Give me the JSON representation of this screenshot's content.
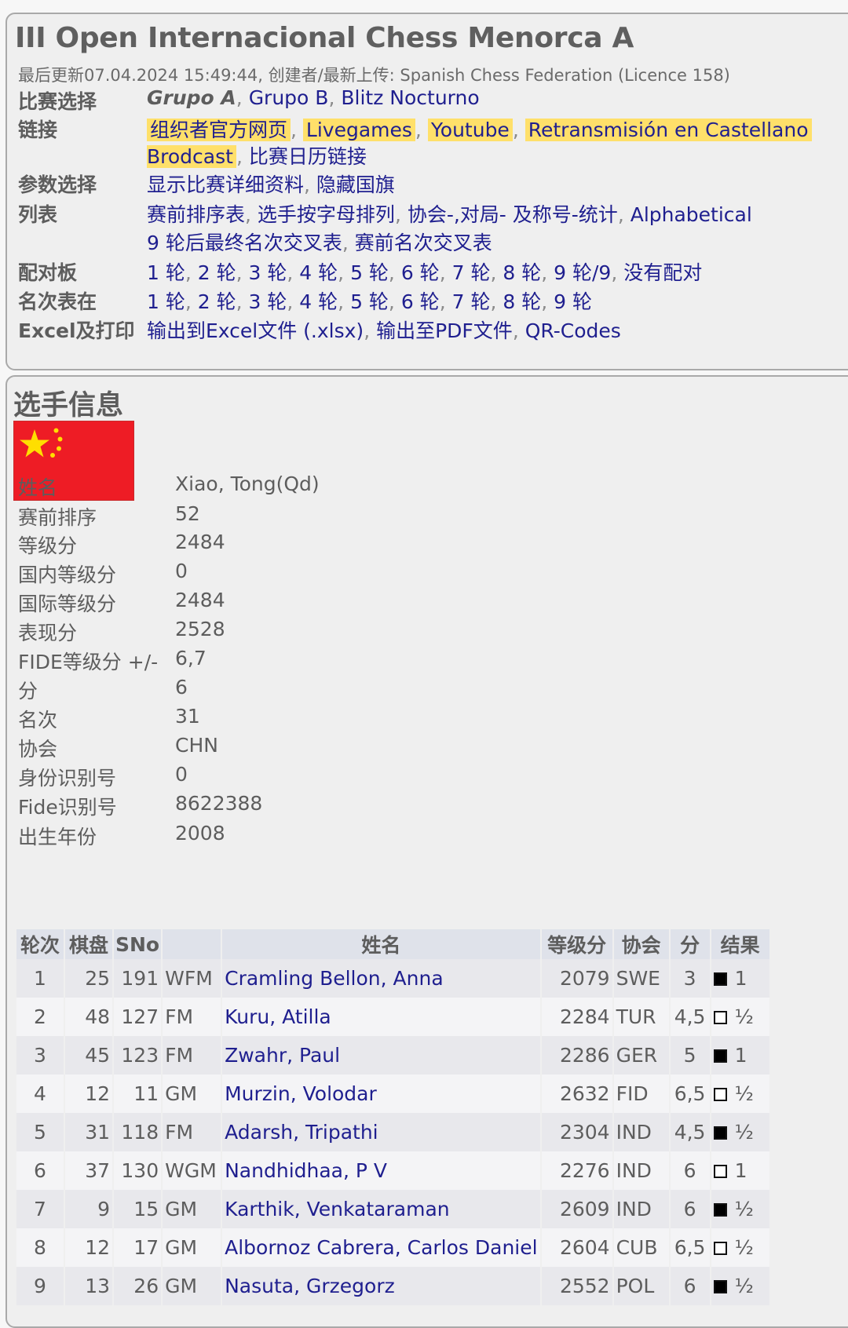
{
  "header": {
    "title": "III Open Internacional Chess Menorca A",
    "updated": "最后更新07.04.2024 15:49:44, 创建者/最新上传: Spanish Chess Federation (Licence 158)"
  },
  "nav": {
    "tournament_select": {
      "label": "比赛选择",
      "current": "Grupo A",
      "items": [
        "Grupo B",
        "Blitz Nocturno"
      ]
    },
    "links": {
      "label": "链接",
      "highlighted": [
        "组织者官方网页",
        "Livegames",
        "Youtube",
        "Retransmisión en Castellano",
        "Brodcast"
      ],
      "items": [
        "比赛日历链接"
      ]
    },
    "parameters": {
      "label": "参数选择",
      "items": [
        "显示比赛详细资料",
        "隐藏国旗"
      ]
    },
    "lists": {
      "label": "列表",
      "items": [
        "赛前排序表",
        "选手按字母排列",
        "协会-,对局- 及称号-统计",
        "Alphabetical",
        "9 轮后最终名次交叉表",
        "赛前名次交叉表"
      ]
    },
    "pairings": {
      "label": "配对板",
      "items": [
        "1 轮",
        "2 轮",
        "3 轮",
        "4 轮",
        "5 轮",
        "6 轮",
        "7 轮",
        "8 轮",
        "9 轮/9",
        "没有配对"
      ]
    },
    "standings": {
      "label": "名次表在",
      "items": [
        "1 轮",
        "2 轮",
        "3 轮",
        "4 轮",
        "5 轮",
        "6 轮",
        "7 轮",
        "8 轮",
        "9 轮"
      ]
    },
    "export": {
      "label": "Excel及打印",
      "items": [
        "输出到Excel文件 (.xlsx)",
        "输出至PDF文件",
        "QR-Codes"
      ]
    }
  },
  "player": {
    "section_title": "选手信息",
    "flag": "china-flag-icon",
    "fields": [
      {
        "label": "姓名",
        "value": "Xiao, Tong(Qd)"
      },
      {
        "label": "赛前排序",
        "value": "52"
      },
      {
        "label": "等级分",
        "value": "2484"
      },
      {
        "label": "国内等级分",
        "value": "0"
      },
      {
        "label": "国际等级分",
        "value": "2484"
      },
      {
        "label": "表现分",
        "value": "2528"
      },
      {
        "label": "FIDE等级分 +/-",
        "value": "6,7"
      },
      {
        "label": "分",
        "value": "6"
      },
      {
        "label": "名次",
        "value": "31"
      },
      {
        "label": "协会",
        "value": "CHN"
      },
      {
        "label": "身份识别号",
        "value": "0"
      },
      {
        "label": "Fide识别号",
        "value": "8622388"
      },
      {
        "label": "出生年份",
        "value": "2008"
      }
    ]
  },
  "games": {
    "headers": [
      "轮次",
      "棋盘",
      "SNo",
      "",
      "姓名",
      "等级分",
      "协会",
      "分",
      "结果"
    ],
    "rows": [
      {
        "round": "1",
        "board": "25",
        "sno": "191",
        "title": "WFM",
        "name": "Cramling Bellon, Anna",
        "rating": "2079",
        "fed": "SWE",
        "pts": "3",
        "color": "black",
        "result": "1"
      },
      {
        "round": "2",
        "board": "48",
        "sno": "127",
        "title": "FM",
        "name": "Kuru, Atilla",
        "rating": "2284",
        "fed": "TUR",
        "pts": "4,5",
        "color": "white",
        "result": "½"
      },
      {
        "round": "3",
        "board": "45",
        "sno": "123",
        "title": "FM",
        "name": "Zwahr, Paul",
        "rating": "2286",
        "fed": "GER",
        "pts": "5",
        "color": "black",
        "result": "1"
      },
      {
        "round": "4",
        "board": "12",
        "sno": "11",
        "title": "GM",
        "name": "Murzin, Volodar",
        "rating": "2632",
        "fed": "FID",
        "pts": "6,5",
        "color": "white",
        "result": "½"
      },
      {
        "round": "5",
        "board": "31",
        "sno": "118",
        "title": "FM",
        "name": "Adarsh, Tripathi",
        "rating": "2304",
        "fed": "IND",
        "pts": "4,5",
        "color": "black",
        "result": "½"
      },
      {
        "round": "6",
        "board": "37",
        "sno": "130",
        "title": "WGM",
        "name": "Nandhidhaa, P V",
        "rating": "2276",
        "fed": "IND",
        "pts": "6",
        "color": "white",
        "result": "1"
      },
      {
        "round": "7",
        "board": "9",
        "sno": "15",
        "title": "GM",
        "name": "Karthik, Venkataraman",
        "rating": "2609",
        "fed": "IND",
        "pts": "6",
        "color": "black",
        "result": "½"
      },
      {
        "round": "8",
        "board": "12",
        "sno": "17",
        "title": "GM",
        "name": "Albornoz Cabrera, Carlos Daniel",
        "rating": "2604",
        "fed": "CUB",
        "pts": "6,5",
        "color": "white",
        "result": "½"
      },
      {
        "round": "9",
        "board": "13",
        "sno": "26",
        "title": "GM",
        "name": "Nasuta, Grzegorz",
        "rating": "2552",
        "fed": "POL",
        "pts": "6",
        "color": "black",
        "result": "½"
      }
    ]
  }
}
